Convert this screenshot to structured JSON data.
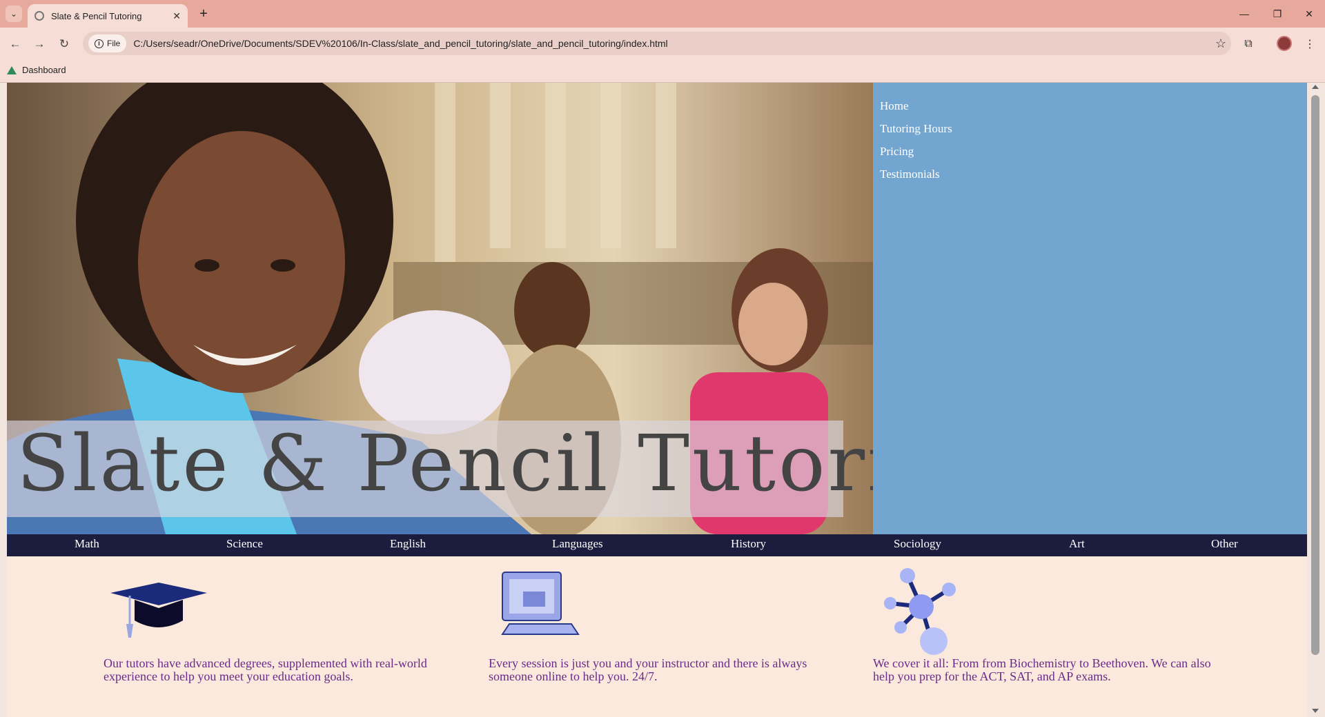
{
  "browser": {
    "tab_title": "Slate & Pencil Tutoring",
    "new_tab_symbol": "+",
    "address_chip": "File",
    "url": "C:/Users/seadr/OneDrive/Documents/SDEV%20106/In-Class/slate_and_pencil_tutoring/slate_and_pencil_tutoring/index.html",
    "bookmarks": [
      {
        "label": "Dashboard"
      }
    ],
    "colors": {
      "frame": "#e6a99b",
      "toolbar": "#f6ded7"
    }
  },
  "hero": {
    "title": "Slate & Pencil Tutoring",
    "image_description_icon": "hero-photo"
  },
  "sidenav": {
    "items": [
      {
        "label": "Home"
      },
      {
        "label": "Tutoring Hours"
      },
      {
        "label": "Pricing"
      },
      {
        "label": "Testimonials"
      }
    ],
    "color": "#72a6d0"
  },
  "subjects": {
    "items": [
      {
        "label": "Math"
      },
      {
        "label": "Science"
      },
      {
        "label": "English"
      },
      {
        "label": "Languages"
      },
      {
        "label": "History"
      },
      {
        "label": "Sociology"
      },
      {
        "label": "Art"
      },
      {
        "label": "Other"
      }
    ],
    "color": "#1c1c3e"
  },
  "features": [
    {
      "icon": "graduation-cap-icon",
      "text": "Our tutors have advanced degrees, supplemented with real-world experience to help you meet your education goals."
    },
    {
      "icon": "computer-icon",
      "text": "Every session is just you and your instructor and there is always someone online to help you. 24/7."
    },
    {
      "icon": "molecule-icon",
      "text": "We cover it all: From from Biochemistry to Beethoven. We can also help you prep for the ACT, SAT, and AP exams."
    }
  ]
}
